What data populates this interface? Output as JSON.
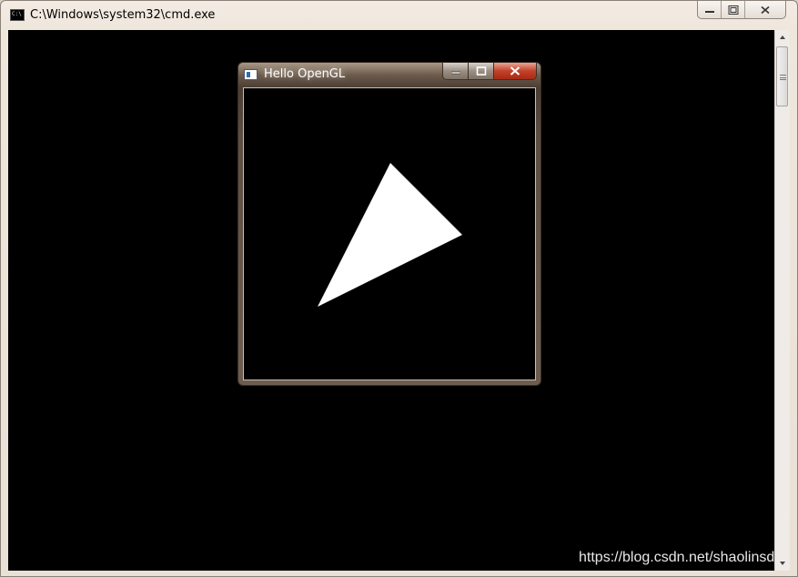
{
  "cmd_window": {
    "title": "C:\\Windows\\system32\\cmd.exe",
    "icon": "cmd-icon"
  },
  "gl_window": {
    "title": "Hello OpenGL",
    "icon": "opengl-app-icon",
    "triangle_color": "#ffffff",
    "background_color": "#000000"
  },
  "watermark": {
    "text": "https://blog.csdn.net/shaolinsd"
  }
}
